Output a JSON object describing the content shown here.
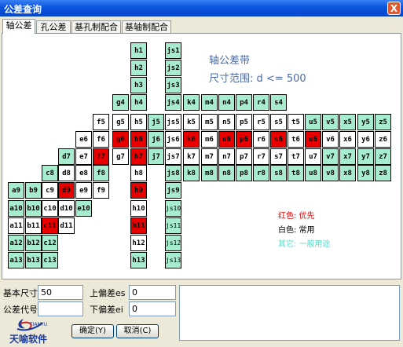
{
  "window": {
    "title": "公差查询",
    "close_symbol": "X"
  },
  "tabs": [
    "轴公差",
    "孔公差",
    "基孔制配合",
    "基轴制配合"
  ],
  "heading": {
    "line1": "轴公差带",
    "line2": "尺寸范围: d <= 500"
  },
  "legend": {
    "red": "红色: 优先",
    "white": "白色: 常用",
    "green": "其它: 一般用途"
  },
  "colors": {
    "green": "#a8ecd0",
    "red": "#e80000",
    "white": "#ffffff"
  },
  "grid": {
    "rows": [
      [
        [
          "h1",
          "g",
          7
        ]
      ],
      [
        [
          "h2",
          "g",
          7
        ]
      ],
      [
        [
          "h3",
          "g",
          7
        ]
      ],
      [
        [
          "g4",
          "g",
          6
        ],
        [
          "h4",
          "g",
          7
        ]
      ],
      [
        [
          "f5",
          "w",
          5
        ],
        [
          "g5",
          "w",
          6
        ],
        [
          "h5",
          "w",
          7
        ],
        [
          "j5",
          "g",
          8
        ]
      ],
      [
        [
          "e6",
          "w",
          4
        ],
        [
          "f6",
          "w",
          5
        ],
        [
          "g6",
          "r",
          6
        ],
        [
          "h6",
          "r",
          7
        ],
        [
          "j6",
          "g",
          8
        ]
      ],
      [
        [
          "d7",
          "g",
          3
        ],
        [
          "e7",
          "w",
          4
        ],
        [
          "f7",
          "r",
          5
        ],
        [
          "g7",
          "w",
          6
        ],
        [
          "h7",
          "r",
          7
        ],
        [
          "j7",
          "g",
          8
        ]
      ],
      [
        [
          "c8",
          "g",
          2
        ],
        [
          "d8",
          "w",
          3
        ],
        [
          "e8",
          "w",
          4
        ],
        [
          "f8",
          "g",
          5
        ],
        [
          "h8",
          "w",
          7
        ]
      ],
      [
        [
          "a9",
          "g",
          0
        ],
        [
          "b9",
          "g",
          1
        ],
        [
          "c9",
          "w",
          2
        ],
        [
          "d9",
          "r",
          3
        ],
        [
          "e9",
          "w",
          4
        ],
        [
          "f9",
          "w",
          5
        ],
        [
          "h9",
          "r",
          7
        ]
      ],
      [
        [
          "a10",
          "g",
          0
        ],
        [
          "b10",
          "g",
          1
        ],
        [
          "c10",
          "w",
          2
        ],
        [
          "d10",
          "w",
          3
        ],
        [
          "e10",
          "g",
          4
        ],
        [
          "h10",
          "w",
          7
        ]
      ],
      [
        [
          "a11",
          "w",
          0
        ],
        [
          "b11",
          "w",
          1
        ],
        [
          "c11",
          "r",
          2
        ],
        [
          "d11",
          "w",
          3
        ],
        [
          "h11",
          "r",
          7
        ]
      ],
      [
        [
          "a12",
          "g",
          0
        ],
        [
          "b12",
          "g",
          1
        ],
        [
          "c12",
          "g",
          2
        ],
        [
          "h12",
          "w",
          7
        ]
      ],
      [
        [
          "a13",
          "g",
          0
        ],
        [
          "b13",
          "g",
          1
        ],
        [
          "c13",
          "g",
          2
        ],
        [
          "h13",
          "g",
          7
        ]
      ]
    ],
    "right_rows": [
      [
        [
          "js1",
          "g",
          0
        ]
      ],
      [
        [
          "js2",
          "g",
          0
        ]
      ],
      [
        [
          "js3",
          "g",
          0
        ]
      ],
      [
        [
          "js4",
          "g",
          0
        ],
        [
          "k4",
          "g",
          1
        ],
        [
          "m4",
          "g",
          2
        ],
        [
          "n4",
          "g",
          3
        ],
        [
          "p4",
          "g",
          4
        ],
        [
          "r4",
          "g",
          5
        ],
        [
          "s4",
          "g",
          6
        ]
      ],
      [
        [
          "js5",
          "w",
          0
        ],
        [
          "k5",
          "w",
          1
        ],
        [
          "m5",
          "w",
          2
        ],
        [
          "n5",
          "w",
          3
        ],
        [
          "p5",
          "w",
          4
        ],
        [
          "r5",
          "w",
          5
        ],
        [
          "s5",
          "w",
          6
        ],
        [
          "t5",
          "w",
          7
        ],
        [
          "u5",
          "g",
          8
        ],
        [
          "v5",
          "g",
          9
        ],
        [
          "x5",
          "g",
          10
        ],
        [
          "y5",
          "g",
          11
        ],
        [
          "z5",
          "g",
          12
        ]
      ],
      [
        [
          "js6",
          "w",
          0
        ],
        [
          "k6",
          "r",
          1
        ],
        [
          "m6",
          "w",
          2
        ],
        [
          "n6",
          "r",
          3
        ],
        [
          "p6",
          "r",
          4
        ],
        [
          "r6",
          "w",
          5
        ],
        [
          "s6",
          "r",
          6
        ],
        [
          "t6",
          "w",
          7
        ],
        [
          "u6",
          "r",
          8
        ],
        [
          "v6",
          "w",
          9
        ],
        [
          "x6",
          "w",
          10
        ],
        [
          "y6",
          "w",
          11
        ],
        [
          "z6",
          "w",
          12
        ]
      ],
      [
        [
          "js7",
          "w",
          0
        ],
        [
          "k7",
          "w",
          1
        ],
        [
          "m7",
          "w",
          2
        ],
        [
          "n7",
          "w",
          3
        ],
        [
          "p7",
          "w",
          4
        ],
        [
          "r7",
          "w",
          5
        ],
        [
          "s7",
          "w",
          6
        ],
        [
          "t7",
          "w",
          7
        ],
        [
          "u7",
          "w",
          8
        ],
        [
          "v7",
          "g",
          9
        ],
        [
          "x7",
          "g",
          10
        ],
        [
          "y7",
          "g",
          11
        ],
        [
          "z7",
          "g",
          12
        ]
      ],
      [
        [
          "js8",
          "g",
          0
        ],
        [
          "k8",
          "g",
          1
        ],
        [
          "m8",
          "g",
          2
        ],
        [
          "n8",
          "g",
          3
        ],
        [
          "p8",
          "g",
          4
        ],
        [
          "r8",
          "g",
          5
        ],
        [
          "s8",
          "g",
          6
        ],
        [
          "t8",
          "g",
          7
        ],
        [
          "u8",
          "g",
          8
        ],
        [
          "v8",
          "g",
          9
        ],
        [
          "x8",
          "g",
          10
        ],
        [
          "y8",
          "g",
          11
        ],
        [
          "z8",
          "g",
          12
        ]
      ],
      [
        [
          "js9",
          "g",
          0
        ]
      ],
      [
        [
          "js10",
          "g",
          0
        ]
      ],
      [
        [
          "js11",
          "g",
          0
        ]
      ],
      [
        [
          "js12",
          "g",
          0
        ]
      ],
      [
        [
          "js13",
          "g",
          0
        ]
      ]
    ]
  },
  "form": {
    "basic_size_label": "基本尺寸",
    "basic_size_value": "50",
    "upper_dev_label": "上偏差es",
    "upper_dev_value": "0",
    "tol_code_label": "公差代号",
    "tol_code_value": "",
    "lower_dev_label": "下偏差ei",
    "lower_dev_value": "0"
  },
  "buttons": {
    "ok": "确定(Y)",
    "cancel": "取消(C)"
  },
  "logo": {
    "text": "天喻软件",
    "small": "TIANYU"
  }
}
